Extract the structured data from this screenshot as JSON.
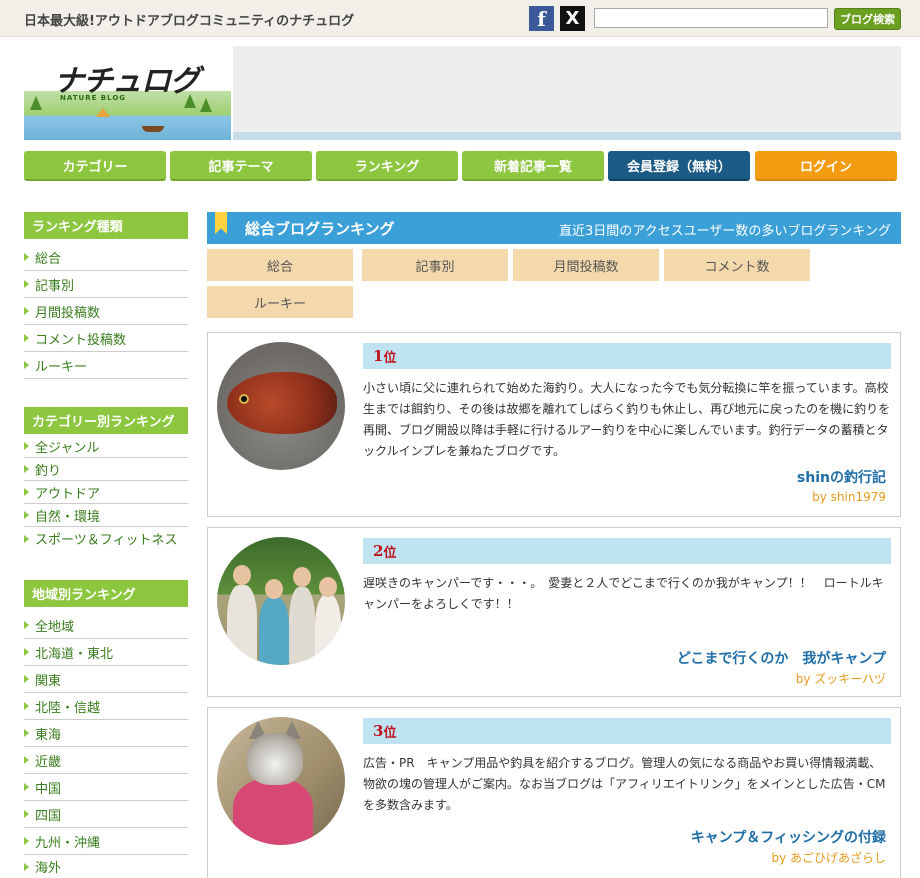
{
  "topbar": {
    "tagline": "日本最大級!アウトドアブログコミュニティのナチュログ",
    "facebook_glyph": "f",
    "x_glyph": "X",
    "search_value": "",
    "search_button": "ブログ検索"
  },
  "header": {
    "logo_text": "ナチュログ",
    "logo_sub": "NATURE BLOG"
  },
  "nav": [
    {
      "label": "カテゴリー"
    },
    {
      "label": "記事テーマ"
    },
    {
      "label": "ランキング"
    },
    {
      "label": "新着記事一覧"
    },
    {
      "label": "会員登録（無料）"
    },
    {
      "label": "ログイン"
    }
  ],
  "sidebar": {
    "ranking_types": {
      "title": "ランキング種類",
      "items": [
        "総合",
        "記事別",
        "月間投稿数",
        "コメント投稿数",
        "ルーキー"
      ]
    },
    "category_ranking": {
      "title": "カテゴリー別ランキング",
      "items": [
        "全ジャンル",
        "釣り",
        "アウトドア",
        "自然・環境",
        "スポーツ＆フィットネス"
      ]
    },
    "region_ranking": {
      "title": "地域別ランキング",
      "items": [
        "全地域",
        "北海道・東北",
        "関東",
        "北陸・信越",
        "東海",
        "近畿",
        "中国",
        "四国",
        "九州・沖縄",
        "海外"
      ]
    }
  },
  "main": {
    "title": "総合ブログランキング",
    "subtitle": "直近3日間のアクセスユーザー数の多いブログランキング",
    "tabs": [
      "総合",
      "記事別",
      "月間投稿数",
      "コメント数",
      "ルーキー"
    ],
    "entries": [
      {
        "rank": "1",
        "unit": "位",
        "description": "小さい頃に父に連れられて始めた海釣り。大人になった今でも気分転換に竿を振っています。高校生までは餌釣り、その後は故郷を離れてしばらく釣りも休止し、再び地元に戻ったのを機に釣りを再開、ブログ開設以降は手軽に行けるルアー釣りを中心に楽しんでいます。釣行データの蓄積とタックルインプレを兼ねたブログです。",
        "blog_title": "shinの釣行記",
        "author": "by shin1979"
      },
      {
        "rank": "2",
        "unit": "位",
        "description": "遅咲きのキャンパーです・・・。　愛妻と２人でどこまで行くのか我がキャンプ！！　ロートルキャンパーをよろしくです！！",
        "blog_title": "どこまで行くのか　我がキャンプ",
        "author": "by ズッキーハヅ"
      },
      {
        "rank": "3",
        "unit": "位",
        "description": "広告・PR　キャンプ用品や釣具を紹介するブログ。管理人の気になる商品やお買い得情報満載、物欲の塊の管理人がご案内。なお当ブログは「アフィリエイトリンク」をメインとした広告・CMを多数含みます。",
        "blog_title": "キャンプ＆フィッシングの付録",
        "author": "by あごひげあざらし"
      }
    ]
  },
  "colors": {
    "green": "#8dc63f",
    "blue_nav": "#1a5a85",
    "orange": "#f39c12",
    "main_header": "#3ba0d8",
    "tab": "#f4d9ac",
    "rank_bar": "#bfe3f1",
    "rank_text": "#c0101a",
    "blog_title": "#1f6ea8",
    "author": "#e89a1e"
  }
}
